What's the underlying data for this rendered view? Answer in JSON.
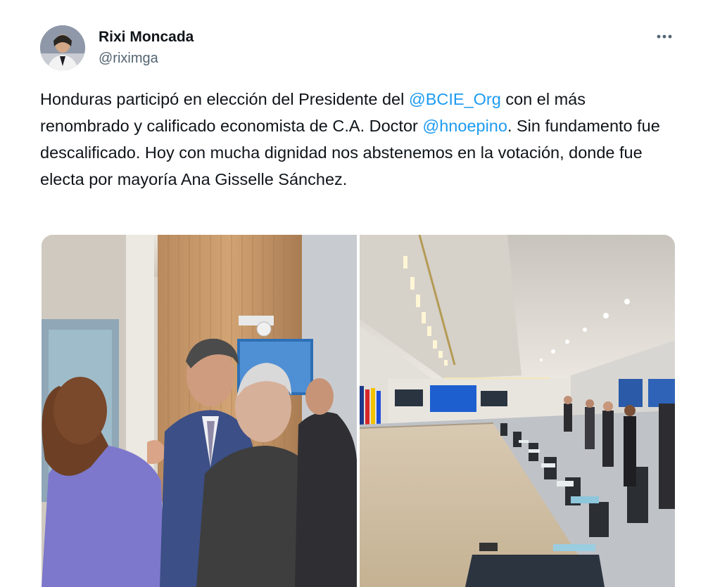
{
  "author": {
    "display_name": "Rixi Moncada",
    "handle": "@riximga",
    "avatar_icon": "profile-photo"
  },
  "more_icon": "more-options-icon",
  "tweet": {
    "segments": [
      {
        "type": "text",
        "text": "Honduras participó en elección del Presidente del "
      },
      {
        "type": "mention",
        "text": "@BCIE_Org"
      },
      {
        "type": "text",
        "text": " con el más renombrado y calificado economista de C.A. Doctor "
      },
      {
        "type": "mention",
        "text": "@hnoepino"
      },
      {
        "type": "text",
        "text": ". Sin fundamento fue descalificado. Hoy con mucha dignidad nos abstenemos en la  votación, donde fue electa por mayoría Ana Gisselle Sánchez."
      }
    ]
  },
  "media": [
    {
      "name": "photo-officials-conversation",
      "kind": "people"
    },
    {
      "name": "photo-conference-room",
      "kind": "room"
    }
  ],
  "colors": {
    "text": "#0f1419",
    "secondary": "#536471",
    "link": "#1d9bf0"
  }
}
